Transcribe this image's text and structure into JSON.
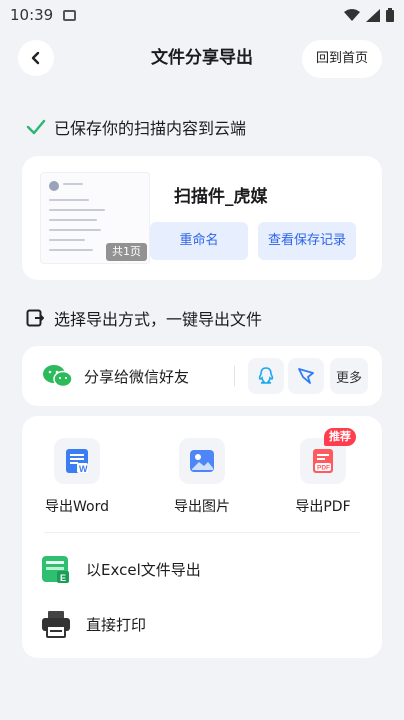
{
  "status": {
    "time": "10:39"
  },
  "header": {
    "back_icon": "chevron-left-icon",
    "title": "文件分享导出",
    "home_button": "回到首页"
  },
  "saved": {
    "message": "已保存你的扫描内容到云端",
    "color": "#2bb673"
  },
  "document": {
    "name": "扫描件_虎媒",
    "page_badge": "共1页",
    "rename": "重命名",
    "view_record": "查看保存记录"
  },
  "export_section": {
    "title": "选择导出方式，一键导出文件"
  },
  "share": {
    "wechat": "分享给微信好友",
    "more": "更多",
    "icons": [
      "wechat-icon",
      "qq-icon",
      "dingtalk-icon"
    ]
  },
  "export_options": {
    "word": "导出Word",
    "image": "导出图片",
    "pdf": "导出PDF",
    "pdf_badge": "推荐",
    "excel": "以Excel文件导出",
    "print": "直接打印"
  },
  "colors": {
    "accent": "#2e63e8",
    "badge": "#ff3d4d",
    "background": "#f1f3f7"
  }
}
